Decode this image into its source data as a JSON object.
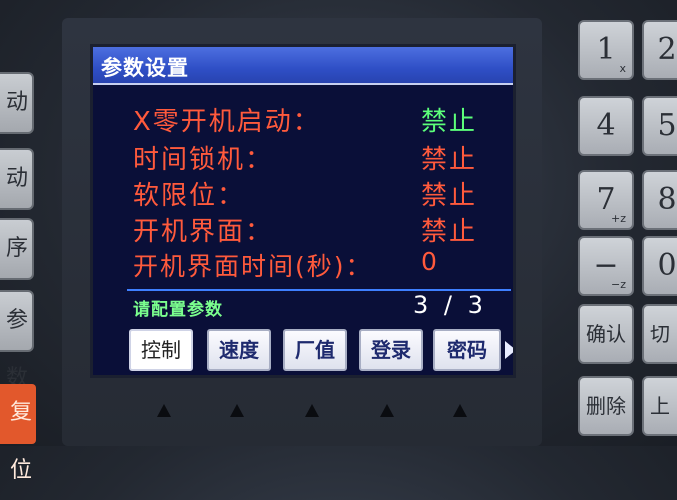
{
  "screen": {
    "title": "参数设置",
    "params": [
      {
        "label": "X零开机启动：",
        "value": "禁止",
        "value_color": "#5cff7a"
      },
      {
        "label": "时间锁机：",
        "value": "禁止",
        "value_color": "#ff5a3c"
      },
      {
        "label": "软限位：",
        "value": "禁止",
        "value_color": "#ff5a3c"
      },
      {
        "label": "开机界面：",
        "value": "禁止",
        "value_color": "#ff5a3c"
      },
      {
        "label": "开机界面时间(秒)：",
        "value": "0",
        "value_color": "#ff5a3c"
      }
    ],
    "prompt": "请配置参数",
    "page_indicator": "3 / 3",
    "softkeys": [
      "控制",
      "速度",
      "厂值",
      "登录",
      "密码"
    ],
    "more_icon": "right-triangle-icon"
  },
  "left_keys": [
    "动",
    "动",
    "序",
    "参数"
  ],
  "reset_key": "复位",
  "right_keys": {
    "k1": {
      "main": "1",
      "sub": "x"
    },
    "k4": {
      "main": "4",
      "sub": ""
    },
    "k7": {
      "main": "7",
      "sub": "+z"
    },
    "kminus": {
      "main": "−",
      "sub": "−z"
    },
    "confirm": "确认",
    "delete": "删除",
    "k2": {
      "main": "2"
    },
    "k5": {
      "main": "5"
    },
    "k8": {
      "main": "8"
    },
    "k0": {
      "main": "0"
    },
    "switch": "切",
    "up": "上"
  },
  "colors": {
    "title_bar": "#2f4fc6",
    "screen_bg": "#0a0f38",
    "label_red": "#ff5a3c",
    "value_green": "#5cff7a",
    "prompt_green": "#7bff8e",
    "reset_orange": "#e2582c"
  }
}
